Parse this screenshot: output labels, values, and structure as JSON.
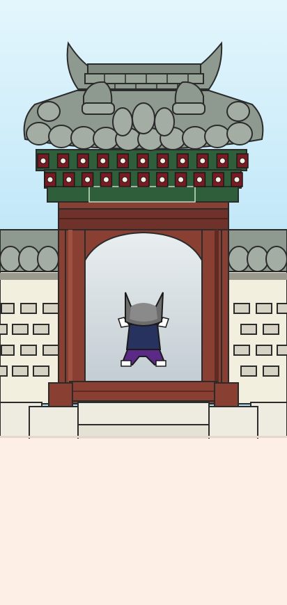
{
  "scene": {
    "setting": "hanok-gate",
    "character": "gray-cat-in-hanbok",
    "colors": {
      "sky_top": "#cfeefb",
      "sky_bottom": "#a9dcf5",
      "roof_tile": "#8e9a8f",
      "roof_tile_dark": "#5f6b62",
      "roof_outline": "#2b2b2b",
      "dancheong_green": "#2f5e3a",
      "dancheong_red": "#7a1a22",
      "pillar_wood": "#8a3f33",
      "pillar_wood_dark": "#5e2a22",
      "wall_plaster": "#f3efdf",
      "wall_brick": "#d6d3c4",
      "step_stone": "#eeece0",
      "ground": "#fdeee6",
      "cat_fur": "#6d6d6d",
      "vest": "#28325f",
      "pants": "#5b2a86"
    }
  }
}
